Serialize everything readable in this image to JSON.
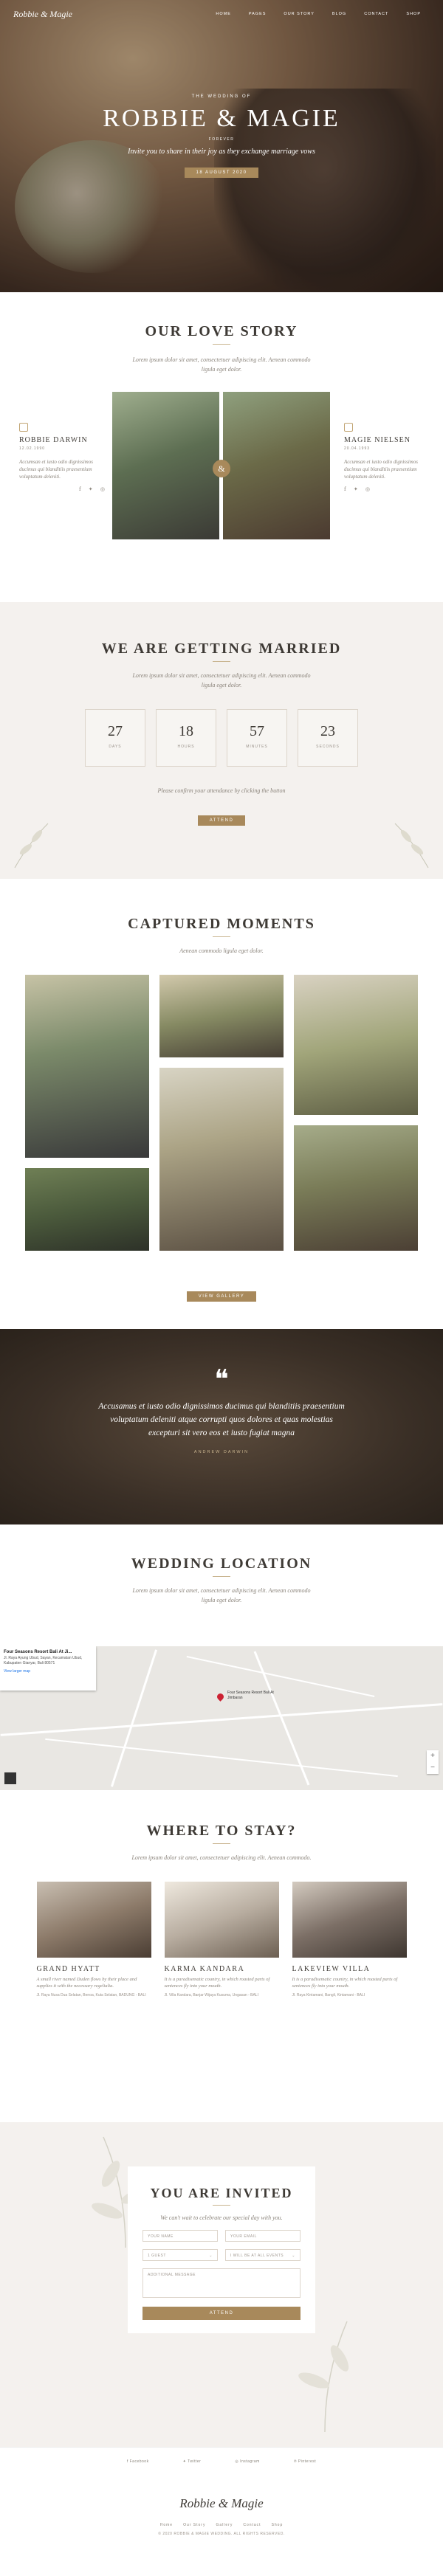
{
  "nav": {
    "logo": "Robbie & Magie",
    "items": [
      "Home",
      "Pages",
      "Our Story",
      "Blog",
      "Contact",
      "Shop"
    ]
  },
  "hero": {
    "pre": "The wedding of",
    "title": "Robbie & Magie",
    "tag": "FOREVER",
    "line": "Invite you to share in their joy as they exchange marriage vows",
    "button": "18 August 2020"
  },
  "love": {
    "title": "Our Love Story",
    "subtitle": "Lorem ipsum dolor sit amet, consectetuer adipiscing elit. Aenean commodo ligula eget dolor.",
    "amp": "&",
    "groom": {
      "name": "Robbie Darwin",
      "date": "12.02.1990",
      "bio": "Accumsan et iusto odio dignissimos ducimus qui blanditiis praesentium voluptatum deleniti.",
      "socials": "f ✦ ◎"
    },
    "bride": {
      "name": "Magie Nielsen",
      "date": "20.04.1993",
      "bio": "Accumsan et iusto odio dignissimos ducimus qui blanditiis praesentium voluptatum deleniti.",
      "socials": "f ✦ ◎"
    }
  },
  "married": {
    "title": "We Are Getting Married",
    "subtitle": "Lorem ipsum dolor sit amet, consectetuer adipiscing elit. Aenean commodo ligula eget dolor.",
    "countdown": [
      {
        "num": "27",
        "label": "Days"
      },
      {
        "num": "18",
        "label": "Hours"
      },
      {
        "num": "57",
        "label": "Minutes"
      },
      {
        "num": "23",
        "label": "Seconds"
      }
    ],
    "note": "Please confirm your attendance by clicking the button",
    "button": "Attend"
  },
  "moments": {
    "title": "Captured Moments",
    "subtitle": "Aenean commodo ligula eget dolor.",
    "button": "View Gallery"
  },
  "quote": {
    "mark": "❝",
    "text": "Accusamus et iusto odio dignissimos ducimus qui blanditiis praesentium voluptatum deleniti atque corrupti quos dolores et quas molestias excepturi sit vero eos et iusto fugiat magna",
    "author": "Andrew Darwin"
  },
  "location": {
    "title": "Wedding Location",
    "subtitle": "Lorem ipsum dolor sit amet, consectetuer adipiscing elit. Aenean commodo ligula eget dolor.",
    "map_card": {
      "title": "Four Seasons Resort Bali At Ji...",
      "address": "Jl. Raya Ayung Ubud, Sayan, Kecamatan Ubud, Kabupaten Gianyar, Bali 80571",
      "link": "View larger map"
    },
    "pin_label": "Four Seasons Resort Bali At Jimbaran"
  },
  "stay": {
    "title": "Where To Stay?",
    "subtitle": "Lorem ipsum dolor sit amet, consectetuer adipiscing elit. Aenean commodo.",
    "hotels": [
      {
        "name": "Grand Hyatt",
        "desc": "A small river named Duden flows by their place and supplies it with the necessary regelialia.",
        "loc": "Jl. Raya Nusa Dua Selatan, Benoa, Kuta Selatan, BADUNG - BALI"
      },
      {
        "name": "Karma Kandara",
        "desc": "It is a paradisematic country, in which roasted parts of sentences fly into your mouth.",
        "loc": "Jl. Villa Kandara, Banjar Wijaya Kusuma, Ungasan - BALI"
      },
      {
        "name": "Lakeview Villa",
        "desc": "It is a paradisematic country, in which roasted parts of sentences fly into your mouth.",
        "loc": "Jl. Raya Kintamani, Bangli, Kintamani - BALI"
      }
    ]
  },
  "invited": {
    "title": "You Are Invited",
    "subtitle": "We can't wait to celebrate our special day with you.",
    "fields": {
      "name": "Your Name",
      "email": "Your Email",
      "guest": "1 Guest",
      "event": "I will be at all events",
      "message": "Additional Message"
    },
    "button": "Attend"
  },
  "footer": {
    "socials": [
      "Facebook",
      "Twitter",
      "Instagram",
      "Pinterest"
    ],
    "logo": "Robbie & Magie",
    "nav": [
      "Home",
      "Our Story",
      "Gallery",
      "Contact",
      "Shop"
    ],
    "copyright": "© 2020 ROBBIE & MAGIE WEDDING. ALL RIGHTS RESERVED."
  }
}
